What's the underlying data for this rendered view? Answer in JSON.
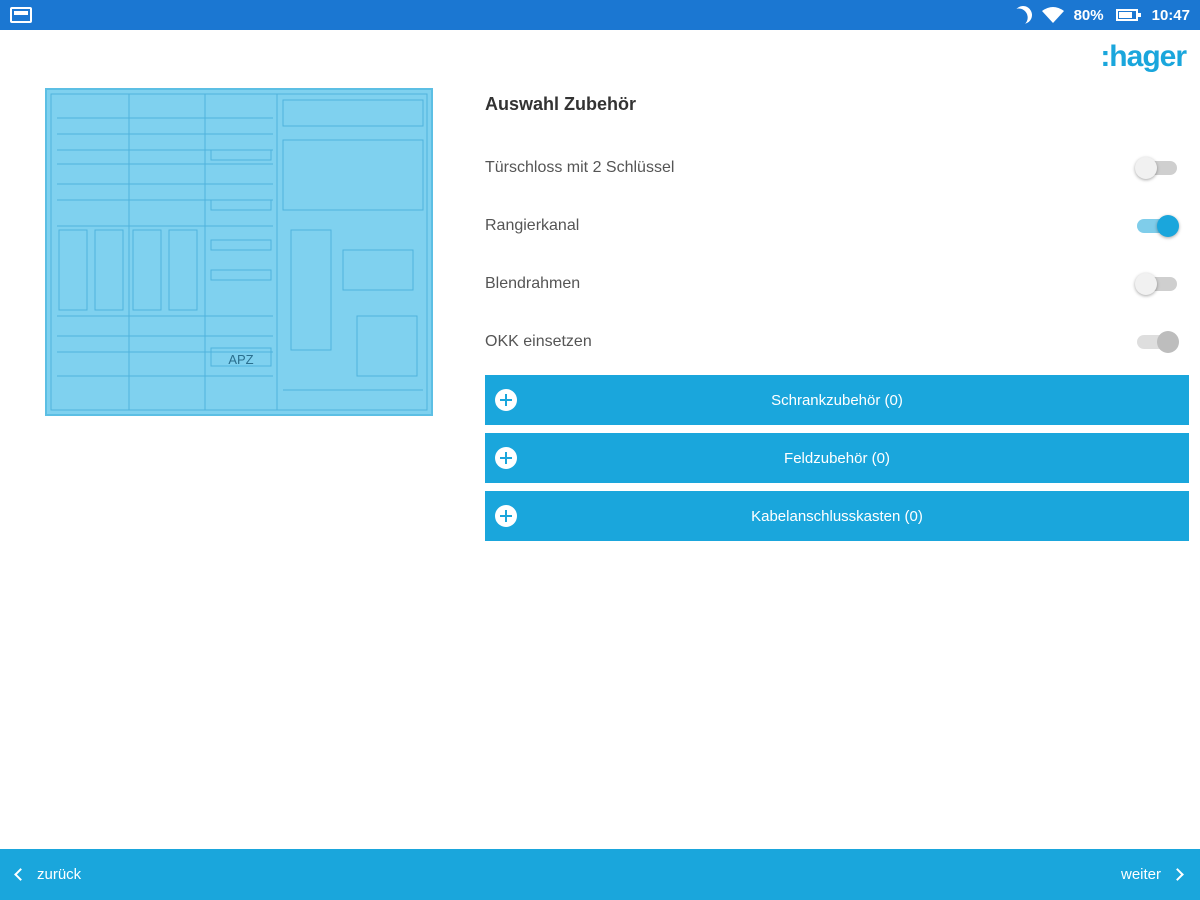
{
  "status_bar": {
    "battery": "80%",
    "time": "10:47"
  },
  "logo": {
    "text": ":hager",
    "color": "#1aa6dc"
  },
  "preview": {
    "label": "APZ"
  },
  "panel": {
    "title": "Auswahl Zubehör",
    "options": [
      {
        "label": "Türschloss mit 2 Schlüssel",
        "state": "off"
      },
      {
        "label": "Rangierkanal",
        "state": "on"
      },
      {
        "label": "Blendrahmen",
        "state": "off"
      },
      {
        "label": "OKK einsetzen",
        "state": "disabled"
      }
    ],
    "sections": [
      {
        "label": "Schrankzubehör (0)",
        "icon": "plus-circle-icon"
      },
      {
        "label": "Feldzubehör (0)",
        "icon": "plus-circle-icon"
      },
      {
        "label": "Kabelanschlusskasten (0)",
        "icon": "plus-circle-icon"
      }
    ]
  },
  "bottom_bar": {
    "back_label": "zurück",
    "next_label": "weiter"
  },
  "colors": {
    "accent": "#1aa6dc",
    "status_bar": "#1b77d2"
  }
}
